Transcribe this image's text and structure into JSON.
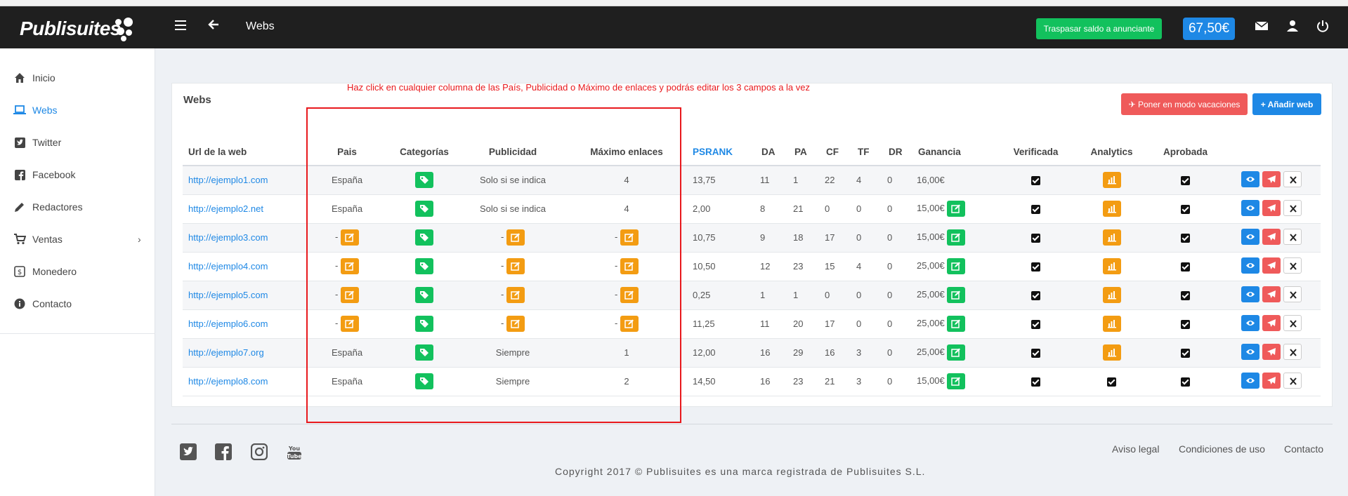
{
  "app": {
    "logo": "Publisuites",
    "page_title": "Webs",
    "transfer_button": "Traspasar saldo a anunciante",
    "balance": "67,50€"
  },
  "sidebar": {
    "items": [
      {
        "label": "Inicio",
        "icon": "home-icon"
      },
      {
        "label": "Webs",
        "icon": "laptop-icon",
        "active": true
      },
      {
        "label": "Twitter",
        "icon": "twitter-icon"
      },
      {
        "label": "Facebook",
        "icon": "facebook-icon"
      },
      {
        "label": "Redactores",
        "icon": "pencil-icon"
      },
      {
        "label": "Ventas",
        "icon": "cart-icon"
      },
      {
        "label": "Monedero",
        "icon": "money-icon"
      },
      {
        "label": "Contacto",
        "icon": "info-icon"
      }
    ]
  },
  "card": {
    "title": "Webs",
    "hint": "Haz click en cualquier columna de las País, Publicidad o Máximo de enlaces y podrás editar los 3 campos a la vez",
    "vacation_button": "Poner en modo vacaciones",
    "add_button": "Añadir web"
  },
  "table": {
    "headers": [
      "Url de la web",
      "Pais",
      "Categorías",
      "Publicidad",
      "Máximo enlaces",
      "PSRANK",
      "DA",
      "PA",
      "CF",
      "TF",
      "DR",
      "Ganancia",
      "Verificada",
      "Analytics",
      "Aprobada"
    ],
    "rows": [
      {
        "url": "http://ejemplo1.com",
        "pais": "España",
        "publicidad": "Solo si se indica",
        "max": "4",
        "psrank": "13,75",
        "da": "11",
        "pa": "1",
        "cf": "22",
        "tf": "4",
        "dr": "0",
        "ganancia": "16,00€",
        "edit_ganancia": false,
        "analytics": true
      },
      {
        "url": "http://ejemplo2.net",
        "pais": "España",
        "publicidad": "Solo si se indica",
        "max": "4",
        "psrank": "2,00",
        "da": "8",
        "pa": "21",
        "cf": "0",
        "tf": "0",
        "dr": "0",
        "ganancia": "15,00€",
        "edit_ganancia": true,
        "analytics": true
      },
      {
        "url": "http://ejemplo3.com",
        "pais": "-",
        "publicidad": "-",
        "max": "-",
        "psrank": "10,75",
        "da": "9",
        "pa": "18",
        "cf": "17",
        "tf": "0",
        "dr": "0",
        "ganancia": "15,00€",
        "edit_ganancia": true,
        "analytics": true
      },
      {
        "url": "http://ejemplo4.com",
        "pais": "-",
        "publicidad": "-",
        "max": "-",
        "psrank": "10,50",
        "da": "12",
        "pa": "23",
        "cf": "15",
        "tf": "4",
        "dr": "0",
        "ganancia": "25,00€",
        "edit_ganancia": true,
        "analytics": true
      },
      {
        "url": "http://ejemplo5.com",
        "pais": "-",
        "publicidad": "-",
        "max": "-",
        "psrank": "0,25",
        "da": "1",
        "pa": "1",
        "cf": "0",
        "tf": "0",
        "dr": "0",
        "ganancia": "25,00€",
        "edit_ganancia": true,
        "analytics": true
      },
      {
        "url": "http://ejemplo6.com",
        "pais": "-",
        "publicidad": "-",
        "max": "-",
        "psrank": "11,25",
        "da": "11",
        "pa": "20",
        "cf": "17",
        "tf": "0",
        "dr": "0",
        "ganancia": "25,00€",
        "edit_ganancia": true,
        "analytics": true
      },
      {
        "url": "http://ejemplo7.org",
        "pais": "España",
        "publicidad": "Siempre",
        "max": "1",
        "psrank": "12,00",
        "da": "16",
        "pa": "29",
        "cf": "16",
        "tf": "3",
        "dr": "0",
        "ganancia": "25,00€",
        "edit_ganancia": true,
        "analytics": true
      },
      {
        "url": "http://ejemplo8.com",
        "pais": "España",
        "publicidad": "Siempre",
        "max": "2",
        "psrank": "14,50",
        "da": "16",
        "pa": "23",
        "cf": "21",
        "tf": "3",
        "dr": "0",
        "ganancia": "15,00€",
        "edit_ganancia": true,
        "analytics": false
      }
    ]
  },
  "footer": {
    "links": [
      "Aviso legal",
      "Condiciones de uso",
      "Contacto"
    ],
    "copyright": "Copyright 2017 © Publisuites es una marca registrada de Publisuites S.L."
  },
  "colors": {
    "accent": "#1e88e5",
    "green": "#12c15d",
    "orange": "#f39c12",
    "red": "#ef5a5a",
    "topbar": "#1f1f1f"
  }
}
